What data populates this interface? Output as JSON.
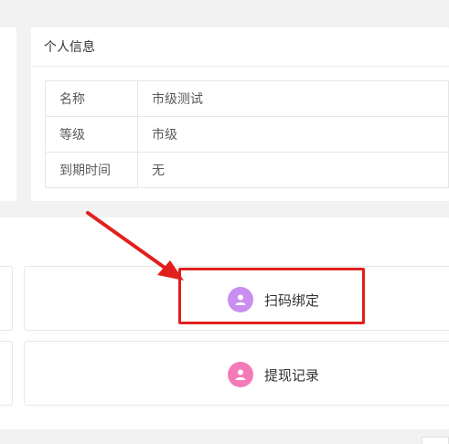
{
  "profile": {
    "title": "个人信息",
    "rows": [
      {
        "label": "名称",
        "value": "市级测试"
      },
      {
        "label": "等级",
        "value": "市级"
      },
      {
        "label": "到期时间",
        "value": "无"
      }
    ]
  },
  "actions": {
    "scan_bind": {
      "label": "扫码绑定",
      "icon": "user-icon",
      "color": "#c98ef0"
    },
    "withdraw_records": {
      "label": "提现记录",
      "icon": "user-icon",
      "color": "#f47bb7"
    }
  },
  "annotation": {
    "highlight_color": "#e1201e"
  }
}
